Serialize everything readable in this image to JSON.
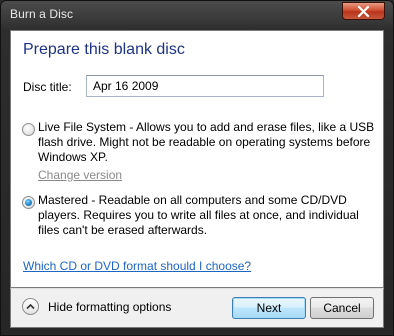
{
  "window": {
    "title": "Burn a Disc",
    "close_icon": "close-icon"
  },
  "main": {
    "heading": "Prepare this blank disc",
    "disc_title_label": "Disc title:",
    "disc_title_value": "Apr 16 2009",
    "options": [
      {
        "lines": [
          "Live File System - Allows you to add and erase files, like a USB",
          "flash drive. Might not be readable on operating systems before",
          "Windows XP."
        ],
        "selected": false
      },
      {
        "lines": [
          "Mastered - Readable on all computers and some CD/DVD",
          "players. Requires you to write all files at once, and individual",
          "files can't be erased afterwards."
        ],
        "selected": true
      }
    ],
    "change_version_label": "Change version",
    "format_help_link": "Which CD or DVD format should I choose?"
  },
  "footer": {
    "toggle_icon": "chevron-up-icon",
    "toggle_label": "Hide formatting options",
    "next_label": "Next",
    "cancel_label": "Cancel"
  },
  "colors": {
    "heading": "#1e3287",
    "link": "#1e66c4",
    "disabled_link": "#8a8a8a",
    "close_button": "#c7563c"
  }
}
